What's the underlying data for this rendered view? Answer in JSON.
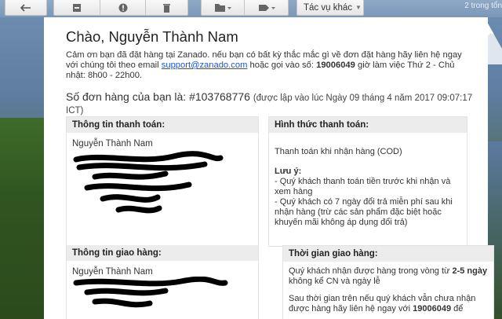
{
  "toolbar": {
    "more_label": "Tác vụ khác",
    "right_text": "2 trong tổn",
    "icons": [
      "back-arrow-icon",
      "archive-icon",
      "spam-icon",
      "trash-icon",
      "folder-icon",
      "label-icon"
    ]
  },
  "email": {
    "greeting": "Chào, Nguyễn Thành Nam",
    "intro_part1": "Cảm ơn bạn đã đặt hàng tại Zanado. nếu bạn có bất kỳ thắc mắc gì về đơn đặt hàng hãy liên hệ ngay với chúng tôi theo email ",
    "support_email": "support@zanado.com",
    "intro_part2": " hoặc gọi vào số: ",
    "hotline": "19006049",
    "intro_part3": " giờ làm việc Thứ 2 - Chủ nhật: 8h00 - 22h00.",
    "order_prefix": "Số đơn hàng của bạn là: #103768776",
    "order_note": "(được lập vào lúc Ngày 09 tháng 4 năm 2017 09:07:17 ICT)"
  },
  "billing": {
    "heading": "Thông tin thanh toán:",
    "name": "Nguyễn Thành Nam"
  },
  "payment": {
    "heading": "Hình thức thanh toán:",
    "method": "Thanh toán khi nhận hàng (COD)",
    "note_title": "Lưu ý:",
    "note_1": "- Quý khách thanh toán tiền trước khi nhận và xem hàng",
    "note_2": "- Quý khách có 7 ngày đổi trả miễn phí sau khi nhận hàng (trừ các sản phẩm đặc biệt hoặc khuyến mãi không áp dụng đổi trả)"
  },
  "shipping": {
    "heading": "Thông tin giao hàng:",
    "name": "Nguyễn Thành Nam"
  },
  "delivery": {
    "heading": "Thời gian giao hàng:",
    "line1_a": "Quý khách nhận được hàng trong vòng từ ",
    "line1_b": "2-5 ngày",
    "line1_c": " không kể CN và ngày lễ",
    "line2_a": "Sau thời gian trên nếu quý khách vẫn chưa nhận được hàng hãy liên hệ ngay với ",
    "line2_b": "19006049",
    "line2_c": " để"
  }
}
